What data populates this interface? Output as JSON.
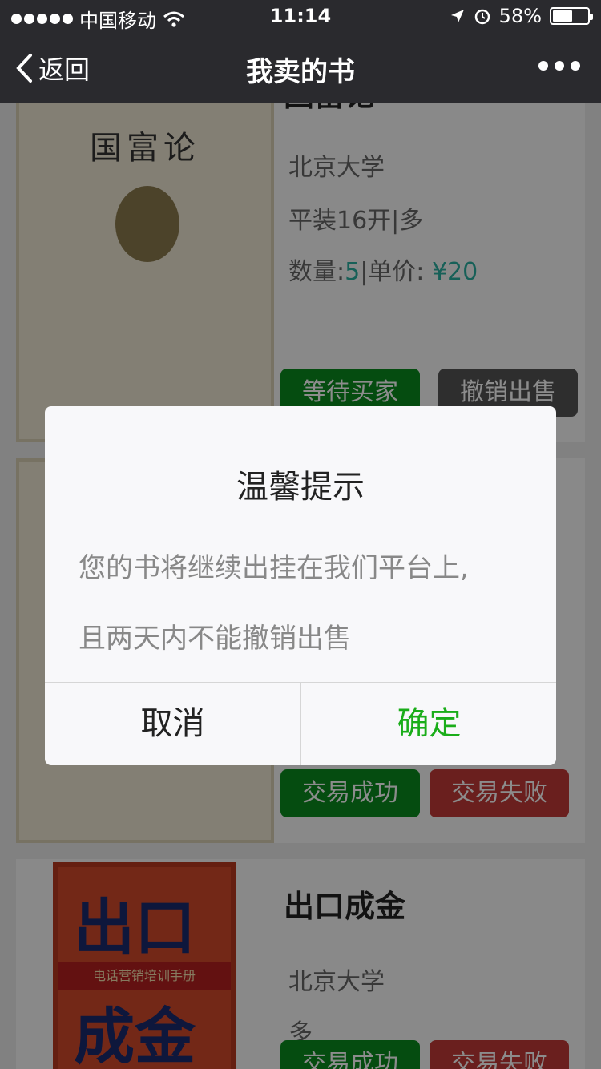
{
  "status_bar": {
    "carrier": "中国移动",
    "time": "11:14",
    "battery_text": "58%",
    "battery_level": 0.58
  },
  "nav": {
    "back_label": "返回",
    "title": "我卖的书"
  },
  "books": [
    {
      "name": "国富论",
      "cover_title": "国富论",
      "publisher": "北京大学",
      "binding": "平装16开|多",
      "quantity_label": "数量:",
      "quantity": "5",
      "price_label": "|单价:",
      "price": "¥20",
      "buttons": [
        "等待买家",
        "撤销出售"
      ]
    },
    {
      "buttons": [
        "交易成功",
        "交易失败"
      ]
    },
    {
      "name": "出口成金",
      "cover_big1": "出口",
      "cover_big2": "成金",
      "cover_stripe": "电话营销培训手册",
      "publisher": "北京大学",
      "binding": "多",
      "buttons": [
        "交易成功",
        "交易失败"
      ]
    }
  ],
  "dialog": {
    "title": "温馨提示",
    "message_line1": "您的书将继续出挂在我们平台上,",
    "message_line2": "且两天内不能撤销出售",
    "cancel_label": "取消",
    "confirm_label": "确定"
  },
  "colors": {
    "nav_bg": "#2a2a2e",
    "accent_green": "#1aad19",
    "price_teal": "#2bb0a0"
  }
}
